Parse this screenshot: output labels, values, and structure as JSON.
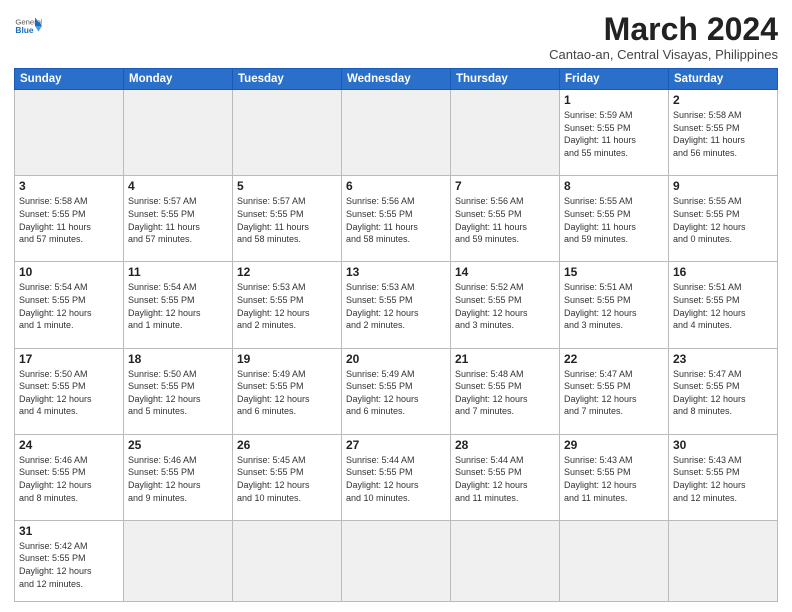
{
  "header": {
    "logo": {
      "general": "General",
      "blue": "Blue"
    },
    "title": "March 2024",
    "subtitle": "Cantao-an, Central Visayas, Philippines"
  },
  "weekdays": [
    "Sunday",
    "Monday",
    "Tuesday",
    "Wednesday",
    "Thursday",
    "Friday",
    "Saturday"
  ],
  "weeks": [
    [
      {
        "day": "",
        "info": ""
      },
      {
        "day": "",
        "info": ""
      },
      {
        "day": "",
        "info": ""
      },
      {
        "day": "",
        "info": ""
      },
      {
        "day": "",
        "info": ""
      },
      {
        "day": "1",
        "info": "Sunrise: 5:59 AM\nSunset: 5:55 PM\nDaylight: 11 hours\nand 55 minutes."
      },
      {
        "day": "2",
        "info": "Sunrise: 5:58 AM\nSunset: 5:55 PM\nDaylight: 11 hours\nand 56 minutes."
      }
    ],
    [
      {
        "day": "3",
        "info": "Sunrise: 5:58 AM\nSunset: 5:55 PM\nDaylight: 11 hours\nand 57 minutes."
      },
      {
        "day": "4",
        "info": "Sunrise: 5:57 AM\nSunset: 5:55 PM\nDaylight: 11 hours\nand 57 minutes."
      },
      {
        "day": "5",
        "info": "Sunrise: 5:57 AM\nSunset: 5:55 PM\nDaylight: 11 hours\nand 58 minutes."
      },
      {
        "day": "6",
        "info": "Sunrise: 5:56 AM\nSunset: 5:55 PM\nDaylight: 11 hours\nand 58 minutes."
      },
      {
        "day": "7",
        "info": "Sunrise: 5:56 AM\nSunset: 5:55 PM\nDaylight: 11 hours\nand 59 minutes."
      },
      {
        "day": "8",
        "info": "Sunrise: 5:55 AM\nSunset: 5:55 PM\nDaylight: 11 hours\nand 59 minutes."
      },
      {
        "day": "9",
        "info": "Sunrise: 5:55 AM\nSunset: 5:55 PM\nDaylight: 12 hours\nand 0 minutes."
      }
    ],
    [
      {
        "day": "10",
        "info": "Sunrise: 5:54 AM\nSunset: 5:55 PM\nDaylight: 12 hours\nand 1 minute."
      },
      {
        "day": "11",
        "info": "Sunrise: 5:54 AM\nSunset: 5:55 PM\nDaylight: 12 hours\nand 1 minute."
      },
      {
        "day": "12",
        "info": "Sunrise: 5:53 AM\nSunset: 5:55 PM\nDaylight: 12 hours\nand 2 minutes."
      },
      {
        "day": "13",
        "info": "Sunrise: 5:53 AM\nSunset: 5:55 PM\nDaylight: 12 hours\nand 2 minutes."
      },
      {
        "day": "14",
        "info": "Sunrise: 5:52 AM\nSunset: 5:55 PM\nDaylight: 12 hours\nand 3 minutes."
      },
      {
        "day": "15",
        "info": "Sunrise: 5:51 AM\nSunset: 5:55 PM\nDaylight: 12 hours\nand 3 minutes."
      },
      {
        "day": "16",
        "info": "Sunrise: 5:51 AM\nSunset: 5:55 PM\nDaylight: 12 hours\nand 4 minutes."
      }
    ],
    [
      {
        "day": "17",
        "info": "Sunrise: 5:50 AM\nSunset: 5:55 PM\nDaylight: 12 hours\nand 4 minutes."
      },
      {
        "day": "18",
        "info": "Sunrise: 5:50 AM\nSunset: 5:55 PM\nDaylight: 12 hours\nand 5 minutes."
      },
      {
        "day": "19",
        "info": "Sunrise: 5:49 AM\nSunset: 5:55 PM\nDaylight: 12 hours\nand 6 minutes."
      },
      {
        "day": "20",
        "info": "Sunrise: 5:49 AM\nSunset: 5:55 PM\nDaylight: 12 hours\nand 6 minutes."
      },
      {
        "day": "21",
        "info": "Sunrise: 5:48 AM\nSunset: 5:55 PM\nDaylight: 12 hours\nand 7 minutes."
      },
      {
        "day": "22",
        "info": "Sunrise: 5:47 AM\nSunset: 5:55 PM\nDaylight: 12 hours\nand 7 minutes."
      },
      {
        "day": "23",
        "info": "Sunrise: 5:47 AM\nSunset: 5:55 PM\nDaylight: 12 hours\nand 8 minutes."
      }
    ],
    [
      {
        "day": "24",
        "info": "Sunrise: 5:46 AM\nSunset: 5:55 PM\nDaylight: 12 hours\nand 8 minutes."
      },
      {
        "day": "25",
        "info": "Sunrise: 5:46 AM\nSunset: 5:55 PM\nDaylight: 12 hours\nand 9 minutes."
      },
      {
        "day": "26",
        "info": "Sunrise: 5:45 AM\nSunset: 5:55 PM\nDaylight: 12 hours\nand 10 minutes."
      },
      {
        "day": "27",
        "info": "Sunrise: 5:44 AM\nSunset: 5:55 PM\nDaylight: 12 hours\nand 10 minutes."
      },
      {
        "day": "28",
        "info": "Sunrise: 5:44 AM\nSunset: 5:55 PM\nDaylight: 12 hours\nand 11 minutes."
      },
      {
        "day": "29",
        "info": "Sunrise: 5:43 AM\nSunset: 5:55 PM\nDaylight: 12 hours\nand 11 minutes."
      },
      {
        "day": "30",
        "info": "Sunrise: 5:43 AM\nSunset: 5:55 PM\nDaylight: 12 hours\nand 12 minutes."
      }
    ],
    [
      {
        "day": "31",
        "info": "Sunrise: 5:42 AM\nSunset: 5:55 PM\nDaylight: 12 hours\nand 12 minutes."
      },
      {
        "day": "",
        "info": ""
      },
      {
        "day": "",
        "info": ""
      },
      {
        "day": "",
        "info": ""
      },
      {
        "day": "",
        "info": ""
      },
      {
        "day": "",
        "info": ""
      },
      {
        "day": "",
        "info": ""
      }
    ]
  ]
}
